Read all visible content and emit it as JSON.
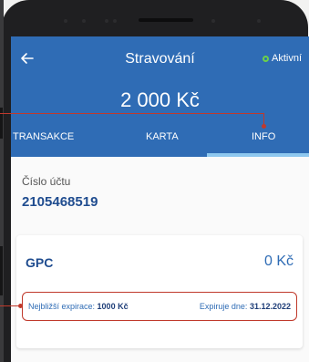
{
  "header": {
    "title": "Stravování",
    "status": "Aktivní",
    "amount": "2 000 Kč"
  },
  "tabs": [
    {
      "label": "TRANSAKCE"
    },
    {
      "label": "KARTA"
    },
    {
      "label": "INFO"
    }
  ],
  "account": {
    "label": "Číslo účtu",
    "number": "2105468519"
  },
  "card": {
    "name": "GPC",
    "balance": "0 Kč",
    "expiry_label": "Nejbližší expirace:",
    "expiry_amount": "1000 Kč",
    "expires_label": "Expiruje dne:",
    "expires_date": "31.12.2022"
  },
  "colors": {
    "header": "#2f6cb5",
    "tab_active_underline": "#8ec8ef",
    "status_dot": "#6cd24a",
    "callout": "#c0392b"
  },
  "icons": [
    "back-arrow-icon",
    "status-dot-icon"
  ]
}
